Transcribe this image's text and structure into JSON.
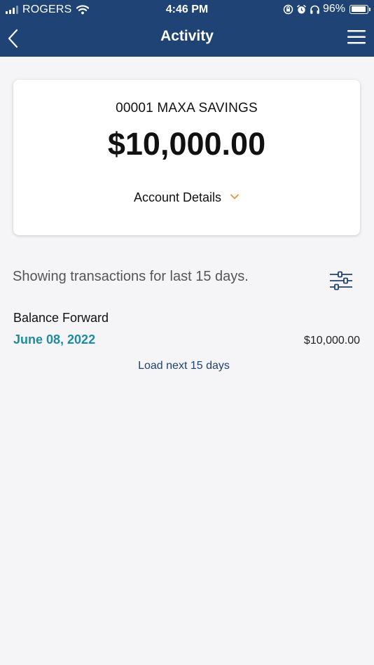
{
  "status_bar": {
    "carrier": "ROGERS",
    "time": "4:46 PM",
    "battery_percent": "96%",
    "battery_level": 0.96,
    "icons": [
      "signal-icon",
      "wifi-icon",
      "rotation-lock-icon",
      "alarm-icon",
      "headphones-icon",
      "battery-icon"
    ]
  },
  "nav": {
    "title": "Activity",
    "back_icon": "chevron-left-icon",
    "menu_icon": "hamburger-menu-icon"
  },
  "account": {
    "name": "00001 MAXA SAVINGS",
    "balance": "$10,000.00",
    "details_label": "Account Details",
    "details_icon": "chevron-down-icon"
  },
  "transactions": {
    "showing_text": "Showing transactions for last 15 days.",
    "filter_icon": "sliders-filter-icon",
    "balance_forward_label": "Balance Forward",
    "balance_forward_date": "June 08, 2022",
    "balance_forward_amount": "$10,000.00",
    "load_next_label": "Load next 15 days"
  },
  "colors": {
    "header_bg": "#1e4374",
    "accent_teal": "#1e8ba3",
    "chevron_orange": "#e0963a",
    "page_bg": "#f5f4f6"
  }
}
